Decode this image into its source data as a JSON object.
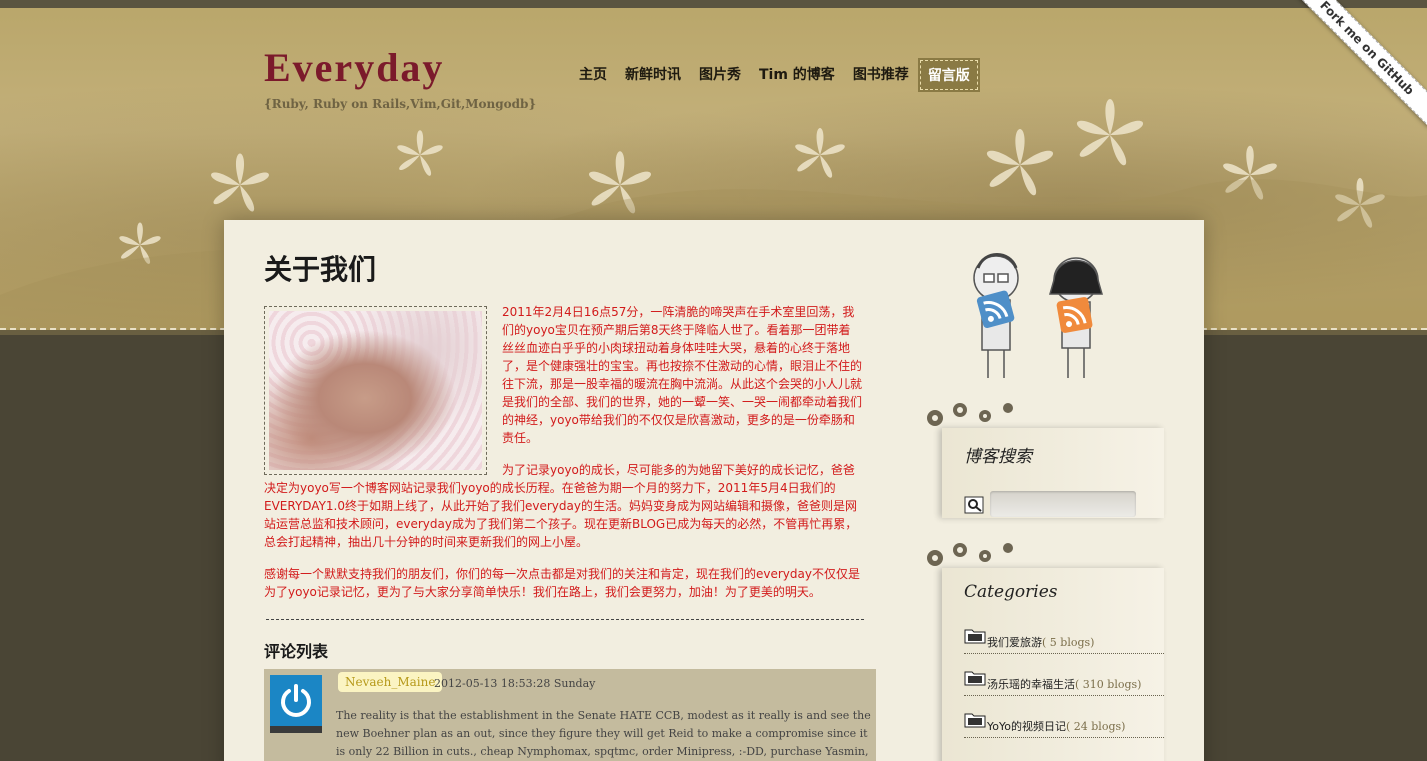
{
  "site": {
    "title": "Everyday",
    "tagline": "{Ruby, Ruby on Rails,Vim,Git,Mongodb}"
  },
  "nav": [
    {
      "label": "主页"
    },
    {
      "label": "新鲜时讯"
    },
    {
      "label": "图片秀"
    },
    {
      "label": "Tim 的博客"
    },
    {
      "label": "图书推荐"
    },
    {
      "label": "留言版",
      "active": true
    }
  ],
  "ribbon": {
    "label": "Fork me on GitHub"
  },
  "page": {
    "title": "关于我们",
    "paragraphs": [
      "2011年2月4日16点57分，一阵清脆的啼哭声在手术室里回荡，我们的yoyo宝贝在预产期后第8天终于降临人世了。看着那一团带着丝丝血迹白乎乎的小肉球扭动着身体哇哇大哭，悬着的心终于落地了，是个健康强壮的宝宝。再也按捺不住激动的心情，眼泪止不住的往下流，那是一股幸福的暖流在胸中流淌。从此这个会哭的小人儿就是我们的全部、我们的世界，她的一颦一笑、一哭一闹都牵动着我们的神经，yoyo带给我们的不仅仅是欣喜激动，更多的是一份牵肠和责任。",
      "为了记录yoyo的成长，尽可能多的为她留下美好的成长记忆，爸爸决定为yoyo写一个博客网站记录我们yoyo的成长历程。在爸爸为期一个月的努力下，2011年5月4日我们的EVERYDAY1.0终于如期上线了，从此开始了我们everyday的生活。妈妈变身成为网站编辑和摄像，爸爸则是网站运营总监和技术顾问，everyday成为了我们第二个孩子。现在更新BLOG已成为每天的必然，不管再忙再累，总会打起精神，抽出几十分钟的时间来更新我们的网上小屋。",
      "感谢每一个默默支持我们的朋友们，你们的每一次点击都是对我们的关注和肯定，现在我们的everyday不仅仅是为了yoyo记录记忆，更为了与大家分享简单快乐！我们在路上，我们会更努力，加油！为了更美的明天。"
    ]
  },
  "comments": {
    "title": "评论列表",
    "items": [
      {
        "author": "Nevaeh_Maine",
        "time": "2012-05-13 18:53:28 Sunday",
        "body": "The reality is that the establishment in the Senate HATE CCB, modest as it really is and see the new Boehner plan as an out, since they figure they will get Reid to make a compromise since it is only 22 Billion in cuts., cheap Nymphomax, spqtmc, order Minipress, :-DD, purchase Yasmin, =-((, Rumalaya online, vwca, Beconase Aq online,"
      }
    ]
  },
  "sidebar": {
    "search": {
      "title": "博客搜索",
      "placeholder": ""
    },
    "categories": {
      "title": "Categories",
      "items": [
        {
          "name": "我们爱旅游",
          "count": "( 5 blogs)"
        },
        {
          "name": "汤乐瑶的幸福生活",
          "count": "( 310 blogs)"
        },
        {
          "name": "YoYo的视频日记",
          "count": "( 24 blogs)"
        }
      ]
    }
  },
  "colors": {
    "brand": "#7b1a2b",
    "article_text": "#d21b1b",
    "header": "#b9a66a",
    "footer_band": "#4a4535"
  }
}
